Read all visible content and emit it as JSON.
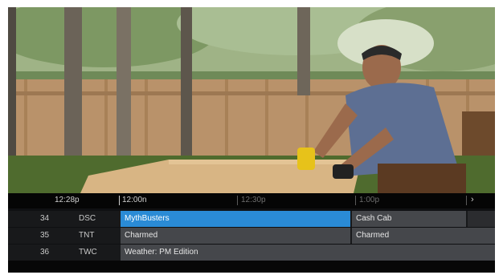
{
  "video": {
    "scene": "home-improvement-show"
  },
  "guide": {
    "current_time": "12:28p",
    "times": [
      "12:00n",
      "12:30p",
      "1:00p"
    ],
    "next_icon": "chevron-right-icon",
    "channels": [
      {
        "number": "34",
        "call": "DSC",
        "programs": [
          "MythBusters",
          "Cash Cab"
        ]
      },
      {
        "number": "35",
        "call": "TNT",
        "programs": [
          "Charmed",
          "Charmed"
        ]
      },
      {
        "number": "36",
        "call": "TWC",
        "programs": [
          "Weather: PM Edition"
        ]
      }
    ],
    "colors": {
      "selected": "#2a8bd6",
      "cell": "#45474b",
      "background": "#0f1012"
    }
  }
}
